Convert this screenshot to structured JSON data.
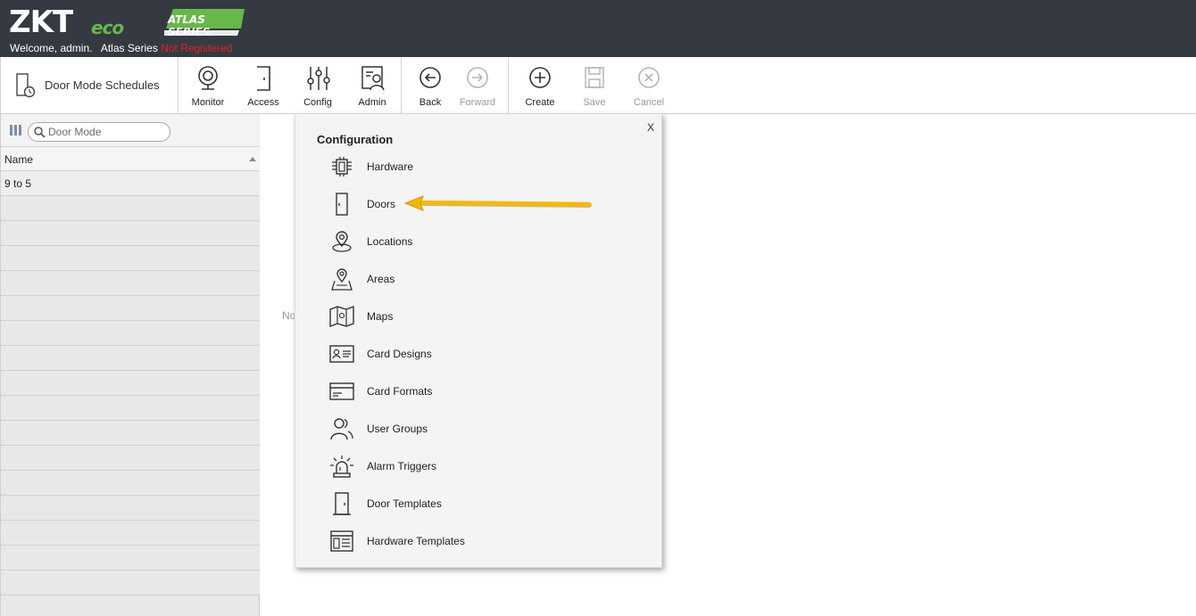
{
  "header": {
    "logo_main": "ZKT",
    "logo_eco": "eco",
    "series_badge": "ATLAS SERIES",
    "welcome": "Welcome, admin.",
    "product": "Atlas Series",
    "registration_status": "Not Registered"
  },
  "toolbar": {
    "page_title": "Door Mode Schedules",
    "buttons": [
      {
        "label": "Monitor",
        "icon": "webcam-icon",
        "enabled": true
      },
      {
        "label": "Access",
        "icon": "door-exit-icon",
        "enabled": true
      },
      {
        "label": "Config",
        "icon": "sliders-icon",
        "enabled": true
      },
      {
        "label": "Admin",
        "icon": "admin-user-icon",
        "enabled": true
      },
      {
        "label": "Back",
        "icon": "arrow-left-circle-icon",
        "enabled": true
      },
      {
        "label": "Forward",
        "icon": "arrow-right-circle-icon",
        "enabled": false
      },
      {
        "label": "Create",
        "icon": "plus-circle-icon",
        "enabled": true
      },
      {
        "label": "Save",
        "icon": "save-icon",
        "enabled": false
      },
      {
        "label": "Cancel",
        "icon": "x-circle-icon",
        "enabled": false
      }
    ]
  },
  "left_panel": {
    "search_placeholder": "Door Mode",
    "column_header": "Name",
    "rows": [
      "9 to 5"
    ]
  },
  "main": {
    "empty_text": "No"
  },
  "config_popup": {
    "close_label": "X",
    "title": "Configuration",
    "items": [
      {
        "label": "Hardware",
        "icon": "chip-icon"
      },
      {
        "label": "Doors",
        "icon": "door-icon"
      },
      {
        "label": "Locations",
        "icon": "location-pin-icon"
      },
      {
        "label": "Areas",
        "icon": "area-map-pin-icon"
      },
      {
        "label": "Maps",
        "icon": "folded-map-icon"
      },
      {
        "label": "Card Designs",
        "icon": "id-card-icon"
      },
      {
        "label": "Card Formats",
        "icon": "credit-card-icon"
      },
      {
        "label": "User Groups",
        "icon": "users-icon"
      },
      {
        "label": "Alarm Triggers",
        "icon": "alarm-light-icon"
      },
      {
        "label": "Door Templates",
        "icon": "door-template-icon"
      },
      {
        "label": "Hardware Templates",
        "icon": "layout-template-icon"
      }
    ]
  },
  "colors": {
    "header_bg": "#353a42",
    "warning_red": "#e32222",
    "logo_green": "#67b74a",
    "annotation_arrow": "#f5b800"
  }
}
